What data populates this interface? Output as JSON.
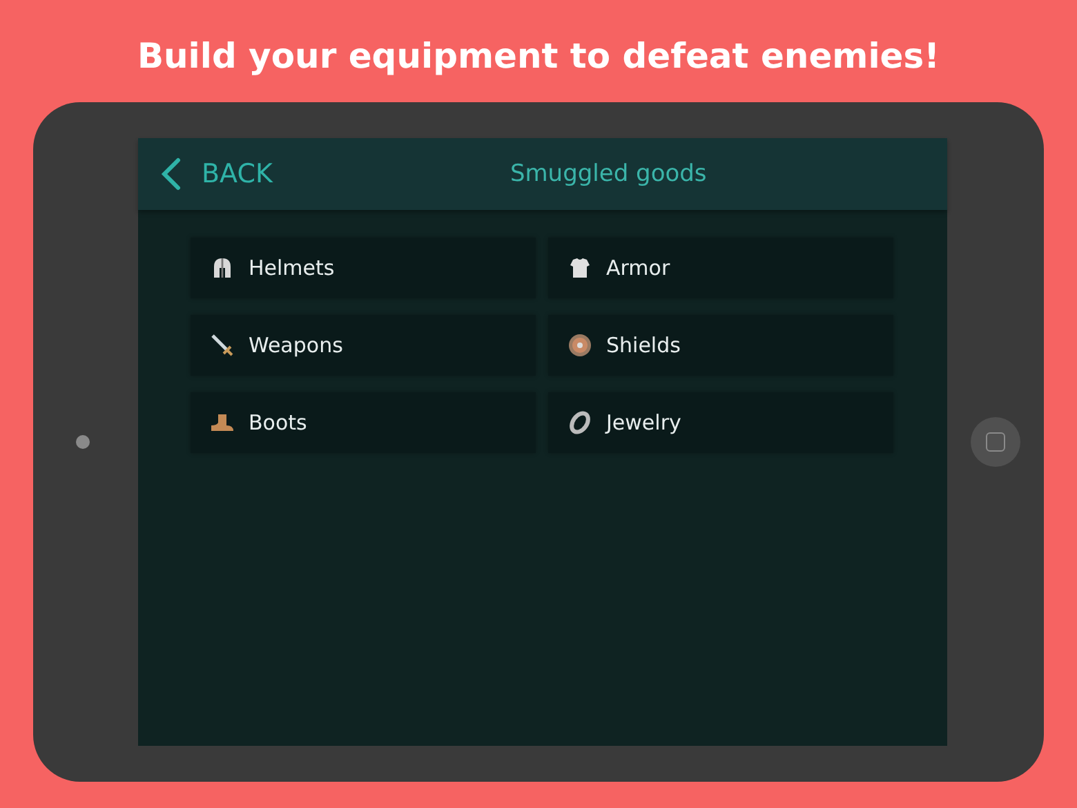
{
  "headline": "Build your equipment to defeat enemies!",
  "header": {
    "back": "BACK",
    "title": "Smuggled goods"
  },
  "categories": [
    {
      "kind": "helmet",
      "label": "Helmets"
    },
    {
      "kind": "armor",
      "label": "Armor"
    },
    {
      "kind": "sword",
      "label": "Weapons"
    },
    {
      "kind": "shield",
      "label": "Shields"
    },
    {
      "kind": "boot",
      "label": "Boots"
    },
    {
      "kind": "ring",
      "label": "Jewelry"
    }
  ]
}
